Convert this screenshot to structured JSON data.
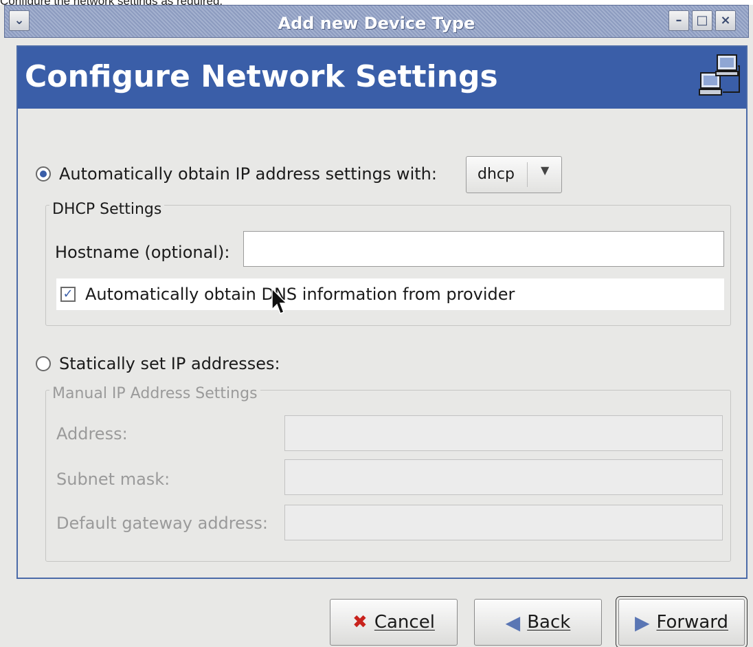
{
  "caption": "Configure the network settings as required.",
  "window": {
    "title": "Add new Device Type",
    "controls": {
      "menu": "⌄",
      "minimize": "–",
      "maximize": "□",
      "close": "×"
    }
  },
  "header": {
    "title": "Configure Network Settings",
    "icon": "network-computers-icon"
  },
  "auto": {
    "label": "Automatically obtain IP address settings with:",
    "selected": true,
    "protocol": "dhcp"
  },
  "dhcp": {
    "group_title": "DHCP Settings",
    "hostname_label": "Hostname (optional):",
    "hostname_value": "",
    "dns_label": "Automatically obtain DNS information from provider",
    "dns_checked": true
  },
  "static": {
    "label": "Statically set IP addresses:",
    "selected": false,
    "group_title": "Manual IP Address Settings",
    "address_label": "Address:",
    "address_value": "",
    "subnet_label": "Subnet mask:",
    "subnet_value": "",
    "gateway_label": "Default gateway address:",
    "gateway_value": ""
  },
  "buttons": {
    "cancel": "Cancel",
    "back": "Back",
    "forward": "Forward"
  },
  "colors": {
    "accent": "#3a5ea8",
    "disabled_text": "#9a9a9a"
  }
}
